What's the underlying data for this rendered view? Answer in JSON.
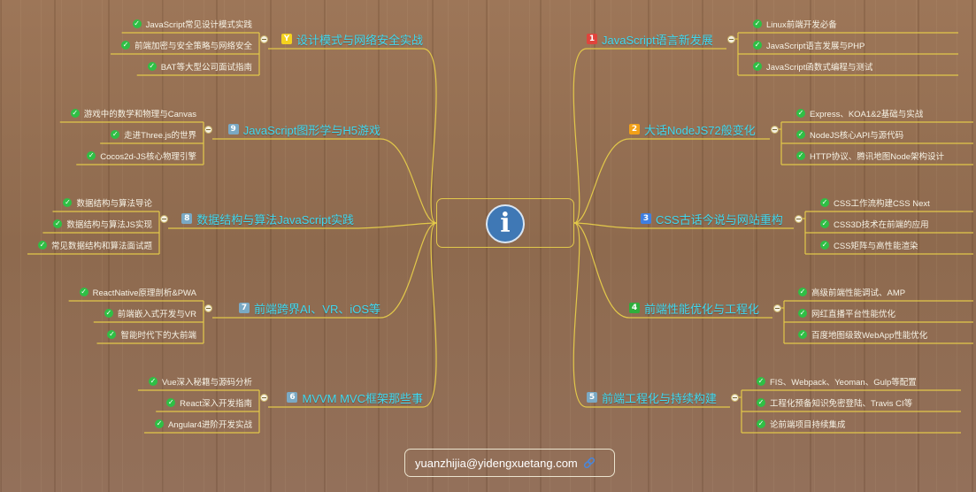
{
  "center": {
    "icon": "info-icon",
    "glyph": "i"
  },
  "footer": {
    "email": "yuanzhijia@yidengxuetang.com",
    "icon": "link-icon"
  },
  "colors": {
    "line": "#e2c84a",
    "topic_text": "#3fd8f0",
    "sub_text": "#f7f3e6",
    "check": "#2fbf45",
    "badge_red": "#e0443c",
    "badge_orange": "#f2a018",
    "badge_blue": "#3f7fe0",
    "badge_green": "#2fae3c",
    "badge_grey": "#7aa9c4",
    "badge_yellow": "#f4d21e"
  },
  "right": [
    {
      "badge": "1",
      "badge_color": "#e0443c",
      "label": "JavaScript语言新发展",
      "items": [
        "Linux前端开发必备",
        "JavaScript语言发展与PHP",
        "JavaScript函数式编程与测试"
      ]
    },
    {
      "badge": "2",
      "badge_color": "#f2a018",
      "label": "大话NodeJS72般变化",
      "items": [
        "Express、KOA1&2基础与实战",
        "NodeJS核心API与源代码",
        "HTTP协议、腾讯地图Node架构设计"
      ]
    },
    {
      "badge": "3",
      "badge_color": "#3f7fe0",
      "label": "CSS古话今说与网站重构",
      "items": [
        "CSS工作流构建CSS Next",
        "CSS3D技术在前端的应用",
        "CSS矩阵与高性能渲染"
      ]
    },
    {
      "badge": "4",
      "badge_color": "#2fae3c",
      "label": "前端性能优化与工程化",
      "items": [
        "高级前端性能调试、AMP",
        "网红直播平台性能优化",
        "百度地图级致WebApp性能优化"
      ]
    },
    {
      "badge": "5",
      "badge_color": "#7aa9c4",
      "label": "前端工程化与持续构建",
      "items": [
        "FIS、Webpack、Yeoman、Gulp等配置",
        "工程化预备知识免密登陆、Travis CI等",
        "论前端项目持续集成"
      ]
    }
  ],
  "left": [
    {
      "badge": "Y",
      "badge_color": "#f4d21e",
      "label": "设计模式与网络安全实战",
      "items": [
        "JavaScript常见设计模式实践",
        "前端加密与安全策略与网络安全",
        "BAT等大型公司面试指南"
      ]
    },
    {
      "badge": "9",
      "badge_color": "#7aa9c4",
      "label": "JavaScript图形学与H5游戏",
      "items": [
        "游戏中的数学和物理与Canvas",
        "走进Three.js的世界",
        "Cocos2d-JS核心物理引擎"
      ]
    },
    {
      "badge": "8",
      "badge_color": "#7aa9c4",
      "label": "数据结构与算法JavaScript实践",
      "items": [
        "数据结构与算法导论",
        "数据结构与算法JS实现",
        "常见数据结构和算法面试题"
      ]
    },
    {
      "badge": "7",
      "badge_color": "#7aa9c4",
      "label": "前端跨界AI、VR、iOS等",
      "items": [
        "ReactNative原理剖析&PWA",
        "前端嵌入式开发与VR",
        "智能时代下的大前端"
      ]
    },
    {
      "badge": "6",
      "badge_color": "#7aa9c4",
      "label": "MVVM MVC框架那些事",
      "items": [
        "Vue深入秘籍与源码分析",
        "React深入开发指南",
        "Angular4进阶开发实战"
      ]
    }
  ]
}
